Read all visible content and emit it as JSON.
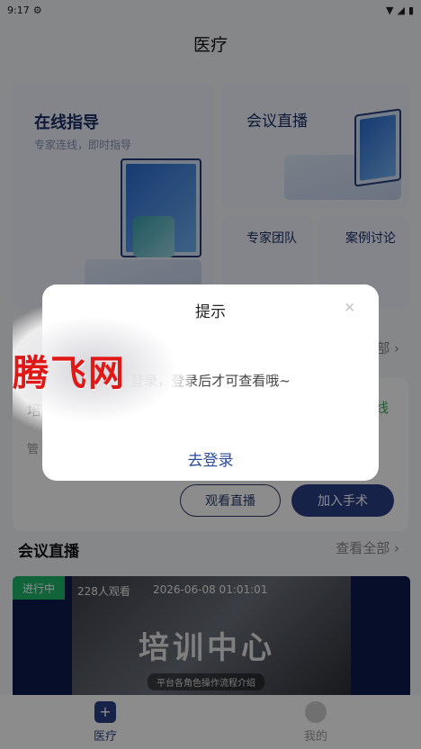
{
  "status_bar": {
    "time": "9:17"
  },
  "header": {
    "title": "医疗"
  },
  "cards": {
    "online": {
      "title": "在线指导",
      "subtitle": "专家连线，即时指导"
    },
    "live": {
      "title": "会议直播"
    },
    "expert": {
      "title": "专家团队"
    },
    "case": {
      "title": "案例讨论"
    }
  },
  "surgery": {
    "title": "培",
    "status": "线",
    "meta": "管",
    "watch_label": "观看直播",
    "join_label": "加入手术",
    "more_label": "部 ›"
  },
  "meeting_section": {
    "title": "会议直播",
    "more_label": "查看全部 ›",
    "item": {
      "badge": "进行中",
      "viewers": "228人观看",
      "time": "2026-06-08 01:01:01",
      "banner": "培训中心",
      "banner_sub": "平台各角色操作流程介绍"
    }
  },
  "tabs": [
    {
      "label": "医疗",
      "icon": "medical-kit-icon"
    },
    {
      "label": "我的",
      "icon": "profile-icon"
    }
  ],
  "dialog": {
    "title": "提示",
    "close": "×",
    "message": "登录，登录后才可查看哦~",
    "button": "去登录"
  },
  "watermark": {
    "text": "腾飞网"
  },
  "colors": {
    "accent": "#2a3e85",
    "live_badge": "#1fb56a",
    "link": "#2a4a9a"
  }
}
